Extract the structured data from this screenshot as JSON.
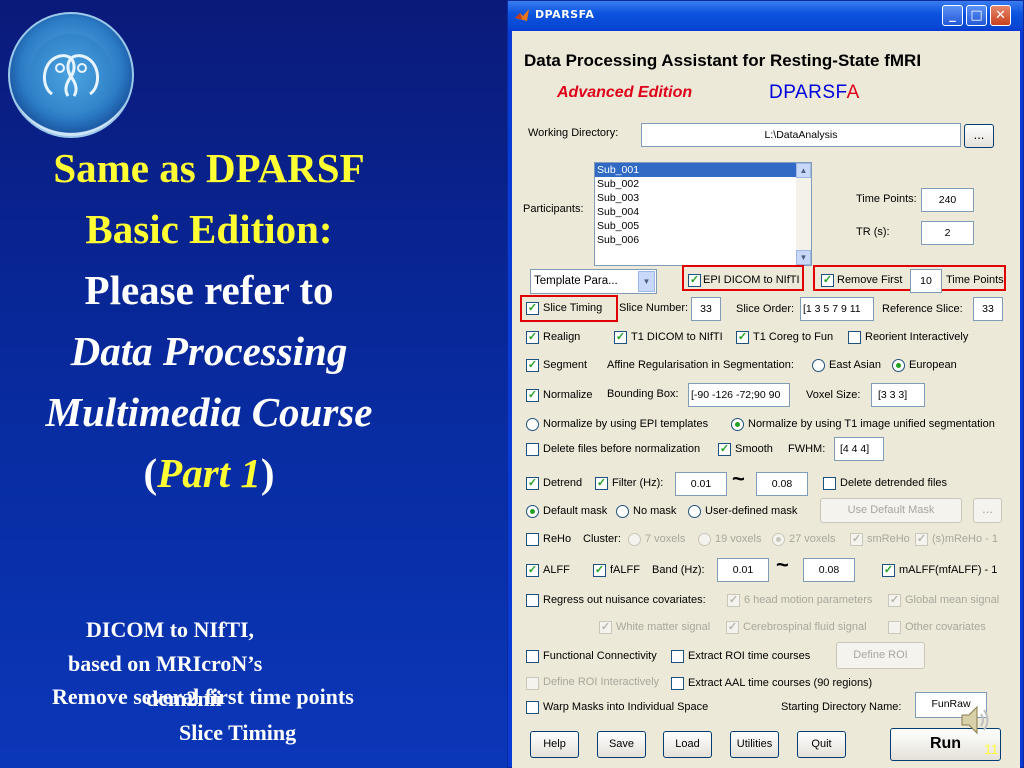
{
  "slide": {
    "title": {
      "line1": "Same as DPARSF",
      "line2": "Basic Edition:",
      "line3": "Please refer to",
      "line4": "Data Processing",
      "line5": "Multimedia Course",
      "line6_open": "(",
      "line6_part": "Part 1",
      "line6_close": ")"
    },
    "captions": {
      "c1": "DICOM to NIfTI,",
      "c2": "based on MRIcroN’s",
      "c3": "dcm2nii",
      "c4": "Remove several first time points",
      "c5": "Slice Timing"
    },
    "page_number": "11",
    "colors": {
      "accent": "#ffff33",
      "background": "#0a2aa0"
    }
  },
  "window": {
    "title": "DPARSFA",
    "heading": "Data Processing Assistant for Resting-State fMRI",
    "edition": "Advanced Edition",
    "brand": "DPARSF",
    "brand_a": "A",
    "working_dir": {
      "label": "Working Directory:",
      "value": "L:\\DataAnalysis",
      "browse": "..."
    },
    "participants": {
      "label": "Participants:",
      "items": [
        "Sub_001",
        "Sub_002",
        "Sub_003",
        "Sub_004",
        "Sub_005",
        "Sub_006"
      ]
    },
    "time_points": {
      "label": "Time Points:",
      "value": "240"
    },
    "tr": {
      "label": "TR (s):",
      "value": "2"
    },
    "template": "Template Para...",
    "epi_dicom": "EPI DICOM to NIfTI",
    "remove_first": {
      "label": "Remove First",
      "value": "10",
      "suffix": "Time Points"
    },
    "slice_timing": "Slice Timing",
    "slice_number": {
      "label": "Slice Number:",
      "value": "33"
    },
    "slice_order": {
      "label": "Slice Order:",
      "value": "[1 3 5 7 9 11"
    },
    "reference_slice": {
      "label": "Reference Slice:",
      "value": "33"
    },
    "realign": "Realign",
    "t1_dicom": "T1 DICOM to NIfTI",
    "t1_coreg": "T1 Coreg to Fun",
    "reorient": "Reorient Interactively",
    "segment": "Segment",
    "affine": "Affine Regularisation in Segmentation:",
    "east_asian": "East Asian",
    "european": "European",
    "normalize": "Normalize",
    "bounding_box": {
      "label": "Bounding Box:",
      "value": "[-90 -126 -72;90 90"
    },
    "voxel_size": {
      "label": "Voxel Size:",
      "value": "[3 3 3]"
    },
    "norm_epi": "Normalize by using EPI templates",
    "norm_t1": "Normalize by using T1 image unified segmentation",
    "delete_files": "Delete files before normalization",
    "smooth": "Smooth",
    "fwhm": {
      "label": "FWHM:",
      "value": "[4 4 4]"
    },
    "detrend": "Detrend",
    "filter": {
      "label": "Filter (Hz):",
      "low": "0.01",
      "high": "0.08"
    },
    "delete_detrended": "Delete detrended files",
    "default_mask": "Default mask",
    "no_mask": "No mask",
    "user_mask": "User-defined mask",
    "use_default_mask": "Use Default Mask",
    "mask_browse": "...",
    "reho": "ReHo",
    "cluster": "Cluster:",
    "v7": "7 voxels",
    "v19": "19 voxels",
    "v27": "27 voxels",
    "smreho": "smReHo",
    "smreho1": "(s)mReHo - 1",
    "alff": "ALFF",
    "falff": "fALFF",
    "band": {
      "label": "Band (Hz):",
      "low": "0.01",
      "high": "0.08"
    },
    "malff": "mALFF(mfALFF) - 1",
    "regress": "Regress out nuisance covariates:",
    "six_head": "6 head motion parameters",
    "global_mean": "Global mean signal",
    "white_matter": "White matter signal",
    "csf": "Cerebrospinal fluid signal",
    "other_cov": "Other covariates",
    "fc": "Functional Connectivity",
    "extract_roi": "Extract ROI time courses",
    "define_roi": "Define ROI",
    "define_roi_int": "Define ROI Interactively",
    "extract_aal": "Extract AAL time courses (90 regions)",
    "warp": "Warp Masks into Individual Space",
    "start_dir": {
      "label": "Starting Directory Name:",
      "value": "FunRaw"
    },
    "buttons": {
      "help": "Help",
      "save": "Save",
      "load": "Load",
      "utilities": "Utilities",
      "quit": "Quit",
      "run": "Run"
    }
  }
}
